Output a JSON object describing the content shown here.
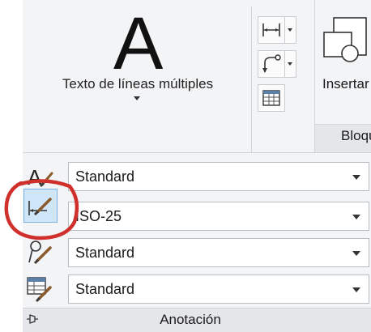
{
  "ribbon": {
    "mtext_label": "Texto de líneas múltiples",
    "insert_label": "Insertar",
    "block_panel_label": "Bloque"
  },
  "annotation_panel": {
    "title": "Anotación",
    "text_style": "Standard",
    "dim_style": "ISO-25",
    "multileader_style": "Standard",
    "table_style": "Standard"
  },
  "icons": {
    "big_text": "A",
    "text_style": "text-style-icon",
    "dim_style": "dimension-style-icon",
    "multileader_style": "multileader-style-icon",
    "table_style": "table-style-icon",
    "linear_dim": "linear-dimension-icon",
    "leader": "leader-icon",
    "table": "table-icon",
    "insert_block": "insert-block-icon",
    "panel_pin": "pin-icon"
  },
  "annotation_mark_color": "#d0302b"
}
